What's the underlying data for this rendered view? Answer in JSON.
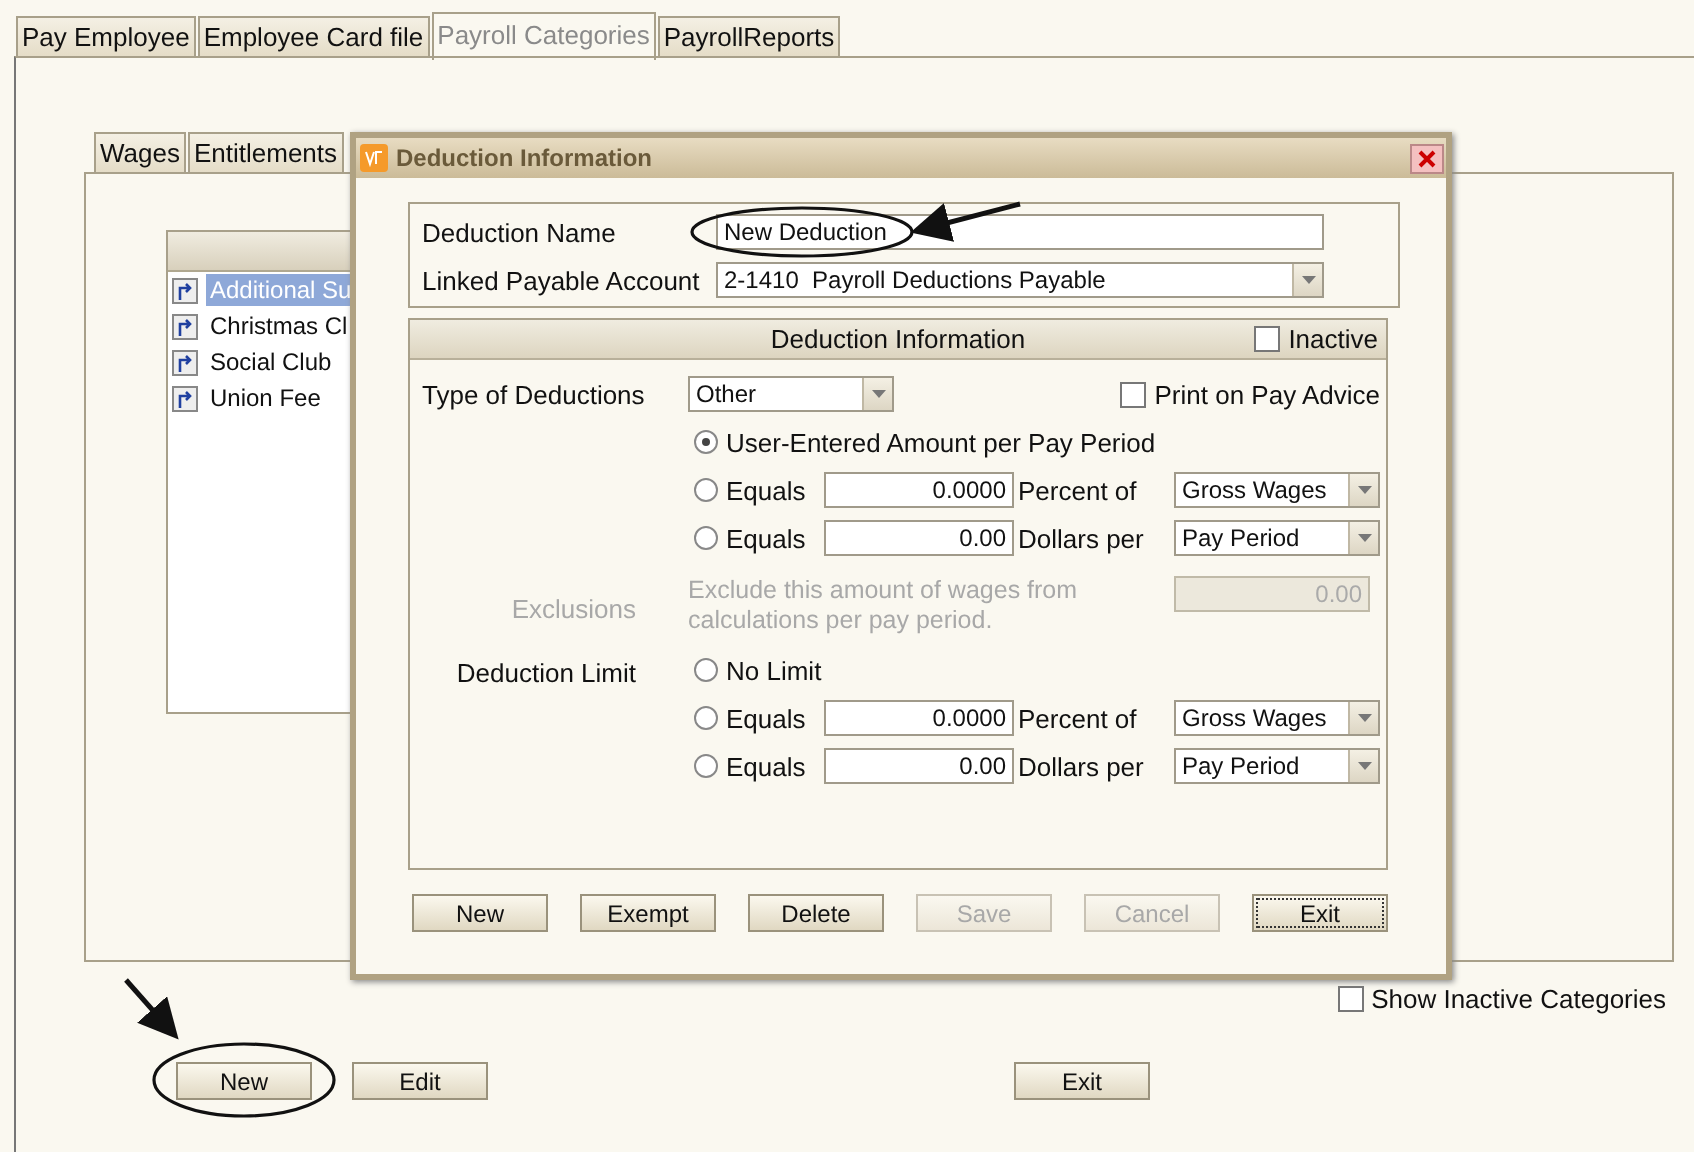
{
  "tabs": [
    {
      "label": "Pay Employee",
      "selected": false
    },
    {
      "label": "Employee Card file",
      "selected": false
    },
    {
      "label": "Payroll Categories",
      "selected": true
    },
    {
      "label": "PayrollReports",
      "selected": false
    }
  ],
  "category_tabs": [
    {
      "label": "Wages",
      "selected": false
    },
    {
      "label": "Entitlements",
      "selected": false
    }
  ],
  "category_list": [
    {
      "label": "Additional Su",
      "selected": true
    },
    {
      "label": "Christmas Cl",
      "selected": false
    },
    {
      "label": "Social Club",
      "selected": false
    },
    {
      "label": "Union Fee",
      "selected": false
    }
  ],
  "show_inactive": {
    "label": "Show Inactive Categories",
    "checked": false
  },
  "buttons": [
    {
      "label": "New",
      "highlighted": true
    },
    {
      "label": "Edit",
      "highlighted": false
    },
    {
      "label": "Exit",
      "highlighted": false
    }
  ],
  "dialog": {
    "title": "Deduction Information",
    "name_field": {
      "label": "Deduction Name",
      "value": "New Deduction",
      "highlighted": true
    },
    "account_field": {
      "label": "Linked Payable Account",
      "value": "2-1410  Payroll Deductions Payable"
    },
    "section": {
      "title": "Deduction Information",
      "inactive": {
        "label": "Inactive",
        "checked": false
      }
    },
    "type_field": {
      "label": "Type of Deductions",
      "value": "Other"
    },
    "print_on_advice": {
      "label": "Print on Pay Advice",
      "checked": false
    },
    "calc_options": [
      {
        "kind": "plain",
        "label": "User-Entered Amount per Pay Period",
        "selected": true
      },
      {
        "kind": "amount",
        "label": "Equals",
        "value": "0.0000",
        "unit": "Percent of",
        "basis": "Gross Wages",
        "selected": false
      },
      {
        "kind": "amount",
        "label": "Equals",
        "value": "0.00",
        "unit": "Dollars per",
        "basis": "Pay Period",
        "selected": false
      }
    ],
    "exclusions": {
      "label": "Exclusions",
      "text": "Exclude this amount of wages from calculations per pay period.",
      "value": "0.00",
      "disabled": true
    },
    "limit": {
      "label": "Deduction Limit",
      "options": [
        {
          "kind": "plain",
          "label": "No Limit",
          "selected": false
        },
        {
          "kind": "amount",
          "label": "Equals",
          "value": "0.0000",
          "unit": "Percent of",
          "basis": "Gross Wages",
          "selected": false
        },
        {
          "kind": "amount",
          "label": "Equals",
          "value": "0.00",
          "unit": "Dollars per",
          "basis": "Pay Period",
          "selected": false
        }
      ]
    },
    "buttons": [
      {
        "label": "New",
        "disabled": false,
        "focused": false
      },
      {
        "label": "Exempt",
        "disabled": false,
        "focused": false
      },
      {
        "label": "Delete",
        "disabled": false,
        "focused": false
      },
      {
        "label": "Save",
        "disabled": true,
        "focused": false
      },
      {
        "label": "Cancel",
        "disabled": true,
        "focused": false
      },
      {
        "label": "Exit",
        "disabled": false,
        "focused": true
      }
    ]
  }
}
